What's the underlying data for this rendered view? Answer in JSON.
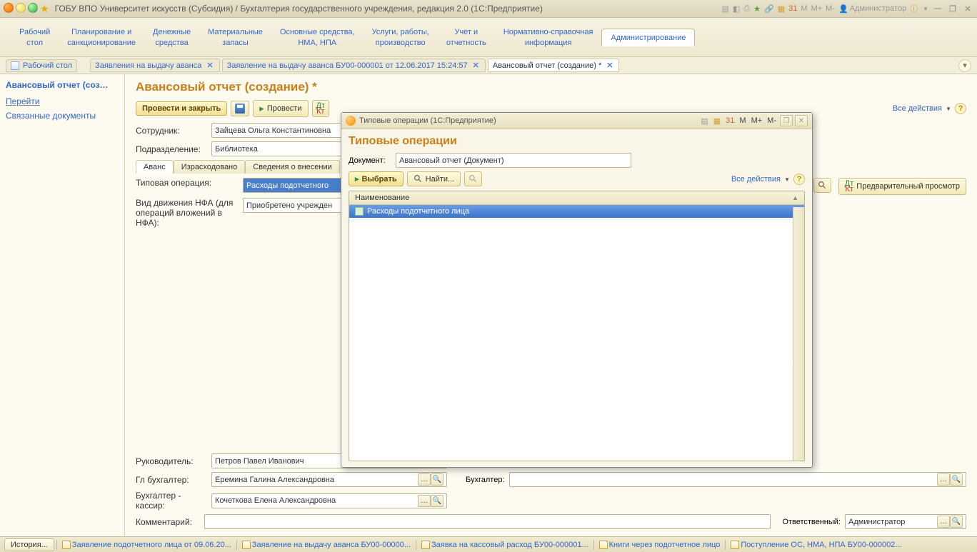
{
  "titlebar": {
    "title": "ГОБУ ВПО Университет искусств (Субсидия) / Бухгалтерия государственного учреждения, редакция 2.0  (1С:Предприятие)",
    "user_label": "Администратор",
    "M_labels": [
      "M",
      "M+",
      "M-"
    ]
  },
  "sections": [
    "Рабочий\nстол",
    "Планирование и\nсанкционирование",
    "Денежные\nсредства",
    "Материальные\nзапасы",
    "Основные средства,\nНМА, НПА",
    "Услуги, работы,\nпроизводство",
    "Учет и\nотчетность",
    "Нормативно-справочная\nинформация",
    "Администрирование"
  ],
  "section_active_idx": 8,
  "tabs": [
    {
      "label": "Рабочий стол",
      "closable": false,
      "has_icon": true
    },
    {
      "label": "Заявления на выдачу аванса",
      "closable": true
    },
    {
      "label": "Заявление на выдачу аванса БУ00-000001 от 12.06.2017 15:24:57",
      "closable": true
    },
    {
      "label": "Авансовый отчет (создание) *",
      "closable": true,
      "active": true
    }
  ],
  "sidebar": {
    "title": "Авансовый отчет (соз…",
    "links": [
      "Перейти",
      "Связанные документы"
    ]
  },
  "content": {
    "title": "Авансовый отчет (создание) *",
    "toolbar": {
      "post_close": "Провести и закрыть",
      "post": "Провести",
      "all_actions": "Все действия"
    },
    "fields": {
      "employee_lbl": "Сотрудник:",
      "employee_val": "Зайцева Ольга Константиновна",
      "dept_lbl": "Подразделение:",
      "dept_val": "Библиотека"
    },
    "inner_tabs": [
      "Аванс",
      "Израсходовано",
      "Сведения о внесении"
    ],
    "inner_active_idx": 0,
    "typical_op_lbl": "Типовая операция:",
    "typical_op_val": "Расходы подотчетного",
    "nfa_move_lbl": "Вид движения НФА (для операций вложений в НФА):",
    "nfa_move_val": "Приобретено учрежден",
    "preview_btn": "Предварительный просмотр",
    "bottom": {
      "head_lbl": "Руководитель:",
      "head_val": "Петров Павел Иванович",
      "chief_acc_lbl": "Гл бухгалтер:",
      "chief_acc_val": "Еремина Галина Александровна",
      "acc_lbl": "Бухгалтер:",
      "acc_val": "",
      "cashier_lbl": "Бухгалтер - кассир:",
      "cashier_val": "Кочеткова Елена Александровна",
      "comment_lbl": "Комментарий:",
      "comment_val": "",
      "responsible_lbl": "Ответственный:",
      "responsible_val": "Администратор"
    }
  },
  "modal": {
    "title": "Типовые операции  (1С:Предприятие)",
    "M_labels": [
      "M",
      "M+",
      "M-"
    ],
    "heading": "Типовые операции",
    "document_lbl": "Документ:",
    "document_val": "Авансовый отчет (Документ)",
    "select_btn": "Выбрать",
    "find_btn": "Найти...",
    "all_actions": "Все действия",
    "col_header": "Наименование",
    "rows": [
      "Расходы подотчетного лица"
    ]
  },
  "statusbar": {
    "history_btn": "История...",
    "items": [
      "Заявление подотчетного лица от 09.06.20...",
      "Заявление на выдачу аванса БУ00-00000...",
      "Заявка на кассовый расход БУ00-000001...",
      "Книги через подотчетное лицо",
      "Поступление ОС, НМА, НПА БУ00-000002..."
    ]
  }
}
